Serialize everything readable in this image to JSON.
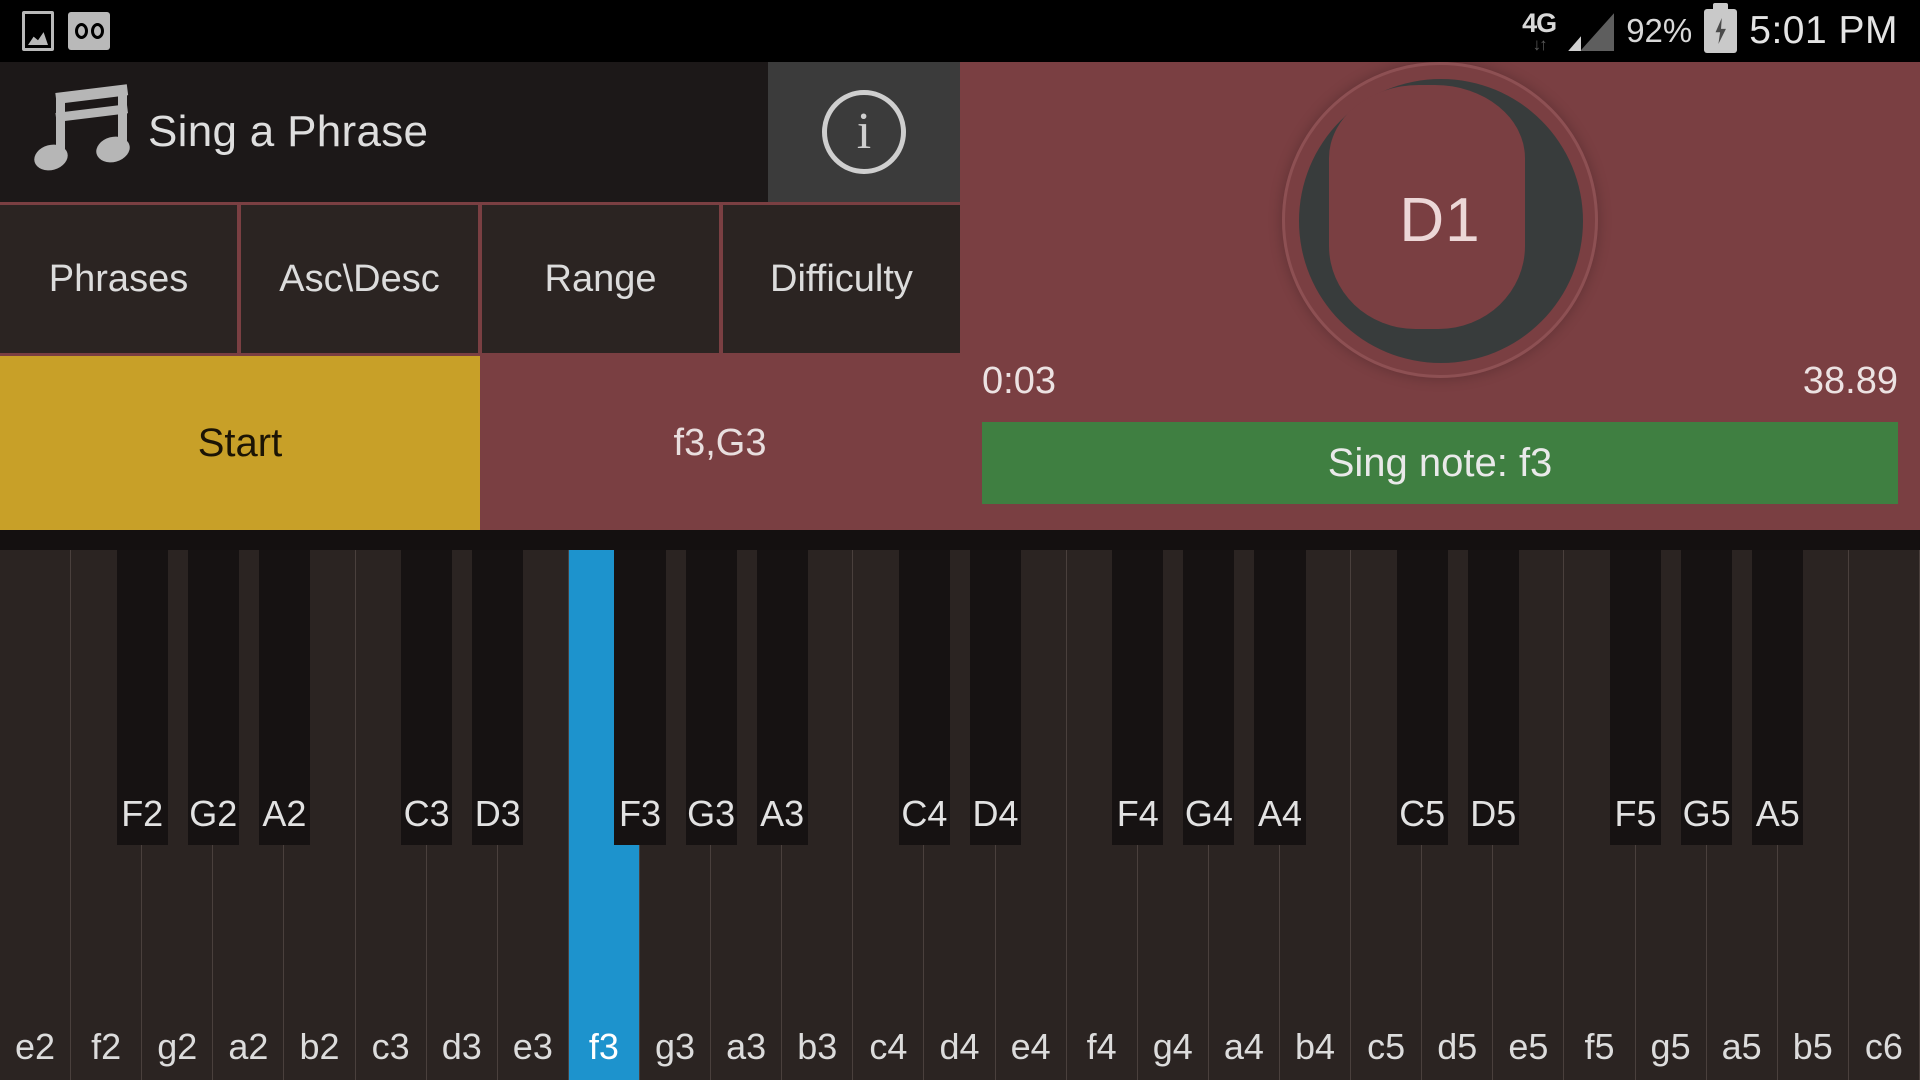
{
  "status_bar": {
    "left_icons": [
      {
        "name": "gallery-icon",
        "glyph": "image"
      },
      {
        "name": "voicemail-icon",
        "glyph": "voicemail"
      }
    ],
    "network_type": "4G",
    "data_arrows": "↓↑",
    "battery_percent": "92%",
    "battery_state": "charging",
    "time": "5:01 PM"
  },
  "header": {
    "app_icon": "music-note-icon",
    "title": "Sing a Phrase",
    "info_button": "i"
  },
  "tabs": [
    {
      "label": "Phrases"
    },
    {
      "label": "Asc\\Desc"
    },
    {
      "label": "Range"
    },
    {
      "label": "Difficulty"
    }
  ],
  "actions": {
    "start_label": "Start",
    "phrase_value": "f3,G3"
  },
  "pitch": {
    "detected_note": "D1",
    "elapsed_time": "0:03",
    "score": "38.89",
    "prompt": "Sing note: f3"
  },
  "colors": {
    "panel_maroon": "#7a3f42",
    "start_gold": "#c8a028",
    "prompt_green": "#3f7f41",
    "active_key_blue": "#1d93cd",
    "dark_chrome": "#1c1818"
  },
  "keyboard": {
    "active_white_key": "f3",
    "white_keys": [
      "e2",
      "f2",
      "g2",
      "a2",
      "b2",
      "c3",
      "d3",
      "e3",
      "f3",
      "g3",
      "a3",
      "b3",
      "c4",
      "d4",
      "e4",
      "f4",
      "g4",
      "a4",
      "b4",
      "c5",
      "d5",
      "e5",
      "f5",
      "g5",
      "a5",
      "b5",
      "c6"
    ],
    "black_keys": [
      {
        "label": "F2",
        "after": "f2"
      },
      {
        "label": "G2",
        "after": "g2"
      },
      {
        "label": "A2",
        "after": "a2"
      },
      {
        "label": "C3",
        "after": "c3"
      },
      {
        "label": "D3",
        "after": "d3"
      },
      {
        "label": "F3",
        "after": "f3"
      },
      {
        "label": "G3",
        "after": "g3"
      },
      {
        "label": "A3",
        "after": "a3"
      },
      {
        "label": "C4",
        "after": "c4"
      },
      {
        "label": "D4",
        "after": "d4"
      },
      {
        "label": "F4",
        "after": "f4"
      },
      {
        "label": "G4",
        "after": "g4"
      },
      {
        "label": "A4",
        "after": "a4"
      },
      {
        "label": "C5",
        "after": "c5"
      },
      {
        "label": "D5",
        "after": "d5"
      },
      {
        "label": "F5",
        "after": "f5"
      },
      {
        "label": "G5",
        "after": "g5"
      },
      {
        "label": "A5",
        "after": "a5"
      }
    ]
  }
}
